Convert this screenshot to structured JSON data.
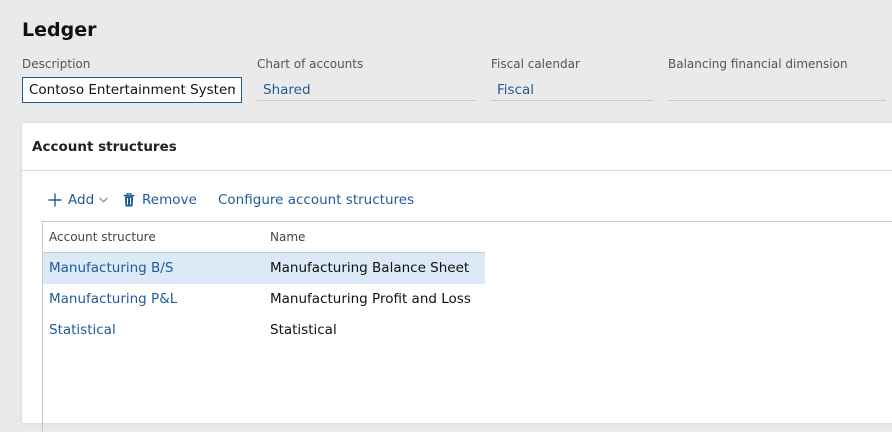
{
  "page": {
    "title": "Ledger"
  },
  "fields": {
    "description": {
      "label": "Description",
      "value": "Contoso Entertainment System USA"
    },
    "chart_of_accounts": {
      "label": "Chart of accounts",
      "value": "Shared"
    },
    "fiscal_calendar": {
      "label": "Fiscal calendar",
      "value": "Fiscal"
    },
    "balancing_dimension": {
      "label": "Balancing financial dimension",
      "value": ""
    }
  },
  "account_structures": {
    "header": "Account structures",
    "toolbar": {
      "add_label": "Add",
      "remove_label": "Remove",
      "configure_label": "Configure account structures"
    },
    "columns": [
      "Account structure",
      "Name"
    ],
    "rows": [
      {
        "structure": "Manufacturing B/S",
        "name": "Manufacturing Balance Sheet",
        "selected": true
      },
      {
        "structure": "Manufacturing P&L",
        "name": "Manufacturing Profit and Loss",
        "selected": false
      },
      {
        "structure": "Statistical",
        "name": "Statistical",
        "selected": false
      }
    ]
  },
  "colors": {
    "link": "#1f5c9a",
    "selected_row": "#dce9f7",
    "background": "#eaeaea"
  },
  "icons": {
    "add": "plus-icon",
    "add_menu": "chevron-down-icon",
    "remove": "trash-icon"
  }
}
